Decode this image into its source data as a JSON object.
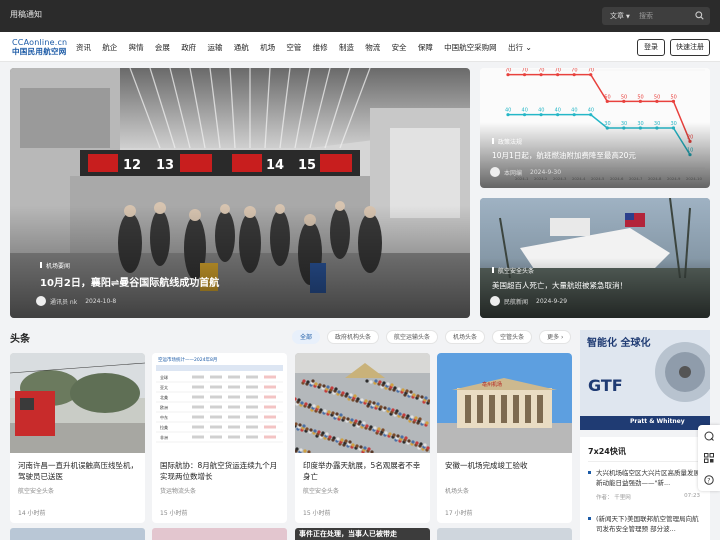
{
  "topbar": {
    "notice": "用稿通知",
    "search_select": "文章",
    "search_placeholder": "搜索"
  },
  "logo": {
    "en": "CCAonline.cn",
    "cn": "中国民用航空网"
  },
  "menu": [
    "资讯",
    "航企",
    "舆情",
    "会展",
    "政府",
    "运输",
    "通航",
    "机场",
    "空管",
    "维修",
    "制造",
    "物流",
    "安全",
    "保障",
    "中国航空采购网",
    "出行"
  ],
  "buttons": {
    "login": "登录",
    "register": "快速注册"
  },
  "hero": {
    "tag": "机场要闻",
    "title": "10月2日，襄阳⇌曼谷国际航线成功首航",
    "author": "通讯员 nk",
    "date": "2024-10-8"
  },
  "gates": [
    "12",
    "13",
    "14",
    "15"
  ],
  "right_top": {
    "tag": "政策法规",
    "title": "10月1日起，航班燃油附加费降至最高20元",
    "author": "本网编",
    "date": "2024-9-30"
  },
  "right_bottom": {
    "tag": "航空安全头条",
    "title": "美国超百人死亡，大量航班被紧急取消！",
    "author": "民航新闻",
    "date": "2024-9-29"
  },
  "fuel_chart": {
    "values_top": [
      70,
      70,
      70,
      70,
      70,
      70,
      50,
      50,
      50,
      50,
      50,
      20
    ],
    "values_bottom": [
      40,
      40,
      40,
      40,
      40,
      40,
      30,
      30,
      30,
      30,
      30,
      10
    ],
    "labels_top": [
      "70",
      "70",
      "70",
      "70",
      "70",
      "70",
      "50",
      "50",
      "50",
      "50",
      "50",
      "20"
    ],
    "labels_bottom": [
      "40",
      "40",
      "40",
      "40",
      "40",
      "40",
      "30",
      "30",
      "30",
      "30",
      "30",
      "10"
    ],
    "x_labels": [
      "2024-1",
      "2024-2",
      "2024-3",
      "2024-4",
      "2024-5",
      "2024-6",
      "2024-7",
      "2024-8",
      "2024-9",
      "2024-10"
    ]
  },
  "section": {
    "title": "头条",
    "tabs": [
      "全部",
      "政府机构头条",
      "航空运输头条",
      "机场头条",
      "空管头条",
      "更多 ›"
    ]
  },
  "news": [
    {
      "title": "河南许昌一直升机误触高压线坠机，驾驶员已送医",
      "category": "航空安全头条",
      "time": "14 小时前"
    },
    {
      "title": "国际航协：8月航空货运连续九个月实现两位数增长",
      "category": "货运物流头条",
      "time": "15 小时前"
    },
    {
      "title": "印度举办露天航展，5名观展者不幸身亡",
      "category": "航空安全头条",
      "time": "15 小时前"
    },
    {
      "title": "安徽一机场完成竣工验收",
      "category": "机场头条",
      "time": "17 小时前"
    }
  ],
  "table_img": {
    "header": "空运市场统计——2024年8月",
    "row_labels": [
      "全球",
      "亚太",
      "北美",
      "欧洲",
      "中东",
      "拉美",
      "非洲"
    ]
  },
  "airport_sign": "亳州机场",
  "ad": {
    "line1": "智能化 全球化",
    "line2": "GTF",
    "brand": "Pratt & Whitney"
  },
  "flash": {
    "title": "7x24快讯",
    "items": [
      {
        "text": "大兴机场临空区大兴片区高质量发展新动能日益强劲——\"新...",
        "author": "作者： 千里网",
        "time": "07:23"
      },
      {
        "text": "(新闻天下)美国联邦航空管理局向航司发布安全管理预 部分波..."
      }
    ]
  },
  "bottom_strip_text": "事件正在处理，当事人已被带走",
  "colors": {
    "accent": "#1b5aa6",
    "topbar": "#2b2b2b",
    "chart_red": "#e8413d",
    "chart_cyan": "#25b7c7"
  }
}
